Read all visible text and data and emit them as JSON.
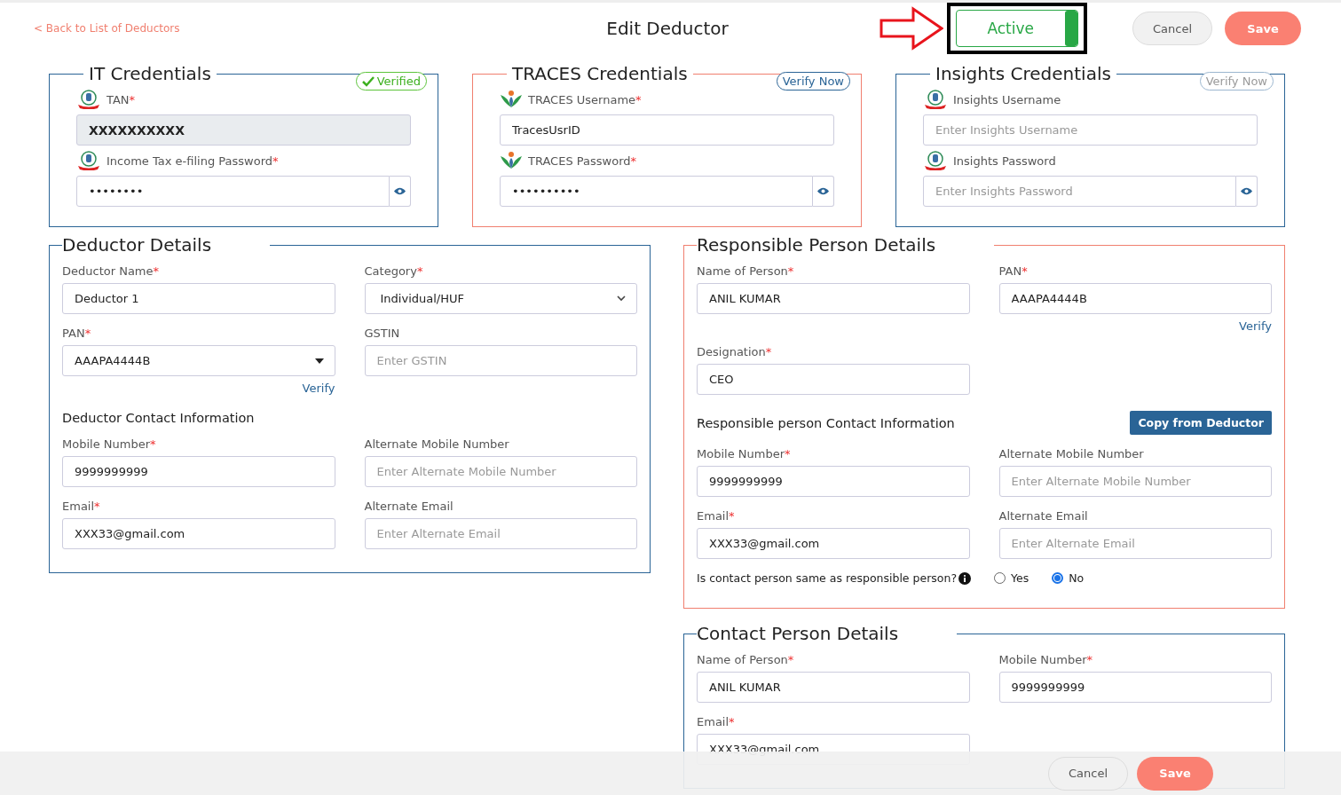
{
  "header": {
    "back_link": "< Back to List of Deductors",
    "title": "Edit Deductor",
    "status_toggle": {
      "label": "Active",
      "on": true
    },
    "buttons": [
      {
        "label": "Cancel",
        "kind": "secondary"
      },
      {
        "label": "Save",
        "kind": "primary"
      }
    ]
  },
  "credentials": [
    {
      "title": "IT Credentials",
      "highlighted": false,
      "badge": {
        "label": "Verified",
        "verified": true,
        "disabled": false
      },
      "fields": [
        {
          "kind": "text",
          "label": "TAN",
          "mark": "*",
          "value": "XXXXXXXXXX",
          "disabled": true
        },
        {
          "kind": "password",
          "label": "Income Tax e-filing Password",
          "mark": "*",
          "value": "••••••••",
          "disabled": false
        }
      ]
    },
    {
      "title": "TRACES Credentials",
      "highlighted": true,
      "badge": {
        "label": "Verify Now",
        "verified": false,
        "disabled": false
      },
      "fields": [
        {
          "kind": "text",
          "label": "TRACES Username",
          "mark": "*",
          "value": "TracesUsrID",
          "disabled": false
        },
        {
          "kind": "password",
          "label": "TRACES Password",
          "mark": "*",
          "value": "••••••••••",
          "disabled": false
        }
      ]
    },
    {
      "title": "Insights Credentials",
      "highlighted": false,
      "badge": {
        "label": "Verify Now",
        "verified": false,
        "disabled": true
      },
      "fields": [
        {
          "kind": "text",
          "label": "Insights Username",
          "placeholder": "Enter Insights Username",
          "disabled": false
        },
        {
          "kind": "password",
          "label": "Insights Password",
          "placeholder": "Enter Insights Password",
          "disabled": false
        }
      ]
    }
  ],
  "sections": [
    {
      "title": "Deductor Details",
      "highlighted": false,
      "items": [
        {
          "kind": "text",
          "label": "Deductor Name",
          "mark": "*",
          "value": "Deductor 1"
        },
        {
          "kind": "select",
          "label": "Category",
          "mark": "*",
          "value": "Individual/HUF"
        },
        {
          "kind": "combo",
          "label": "PAN",
          "mark": "*",
          "value": "AAAPA4444B",
          "link": "Verify"
        },
        {
          "kind": "text",
          "label": "GSTIN",
          "placeholder": "Enter GSTIN"
        },
        {
          "kind": "heading",
          "label": "Deductor Contact Information"
        },
        {
          "kind": "text",
          "label": "Mobile Number",
          "mark": "*",
          "value": "9999999999"
        },
        {
          "kind": "text",
          "label": "Alternate Mobile Number",
          "placeholder": "Enter Alternate Mobile Number"
        },
        {
          "kind": "text",
          "label": "Email",
          "mark": "*",
          "value": "XXX33@gmail.com"
        },
        {
          "kind": "text",
          "label": "Alternate Email",
          "placeholder": "Enter Alternate Email"
        }
      ]
    },
    {
      "title": "Responsible Person Details",
      "highlighted": true,
      "items": [
        {
          "kind": "text",
          "label": "Name of Person",
          "mark": "*",
          "value": "ANIL KUMAR"
        },
        {
          "kind": "text",
          "label": "PAN",
          "mark": "*",
          "value": "AAAPA4444B",
          "link": "Verify"
        },
        {
          "kind": "text",
          "label": "Designation",
          "mark": "*",
          "value": "CEO"
        },
        {
          "kind": "heading",
          "label": "Responsible person Contact Information",
          "button": "Copy from Deductor"
        },
        {
          "kind": "text",
          "label": "Mobile Number",
          "mark": "*",
          "value": "9999999999"
        },
        {
          "kind": "text",
          "label": "Alternate Mobile Number",
          "placeholder": "Enter Alternate Mobile Number"
        },
        {
          "kind": "text",
          "label": "Email",
          "mark": "*",
          "value": "XXX33@gmail.com"
        },
        {
          "kind": "text",
          "label": "Alternate Email",
          "placeholder": "Enter Alternate Email"
        },
        {
          "kind": "radio",
          "label": "Is contact person same as responsible person?",
          "options": [
            {
              "label": "Yes",
              "selected": false
            },
            {
              "label": "No",
              "selected": true
            }
          ]
        }
      ]
    },
    {
      "title": "Contact Person Details",
      "highlighted": false,
      "items": [
        {
          "kind": "text",
          "label": "Name of Person",
          "mark": "*",
          "value": "ANIL KUMAR"
        },
        {
          "kind": "text",
          "label": "Mobile Number",
          "mark": "*",
          "value": "9999999999"
        },
        {
          "kind": "text",
          "label": "Email",
          "mark": "*",
          "value": "XXX33@gmail.com"
        }
      ]
    }
  ],
  "footer": {
    "buttons": [
      {
        "label": "Cancel",
        "kind": "secondary"
      },
      {
        "label": "Save",
        "kind": "primary"
      }
    ]
  }
}
